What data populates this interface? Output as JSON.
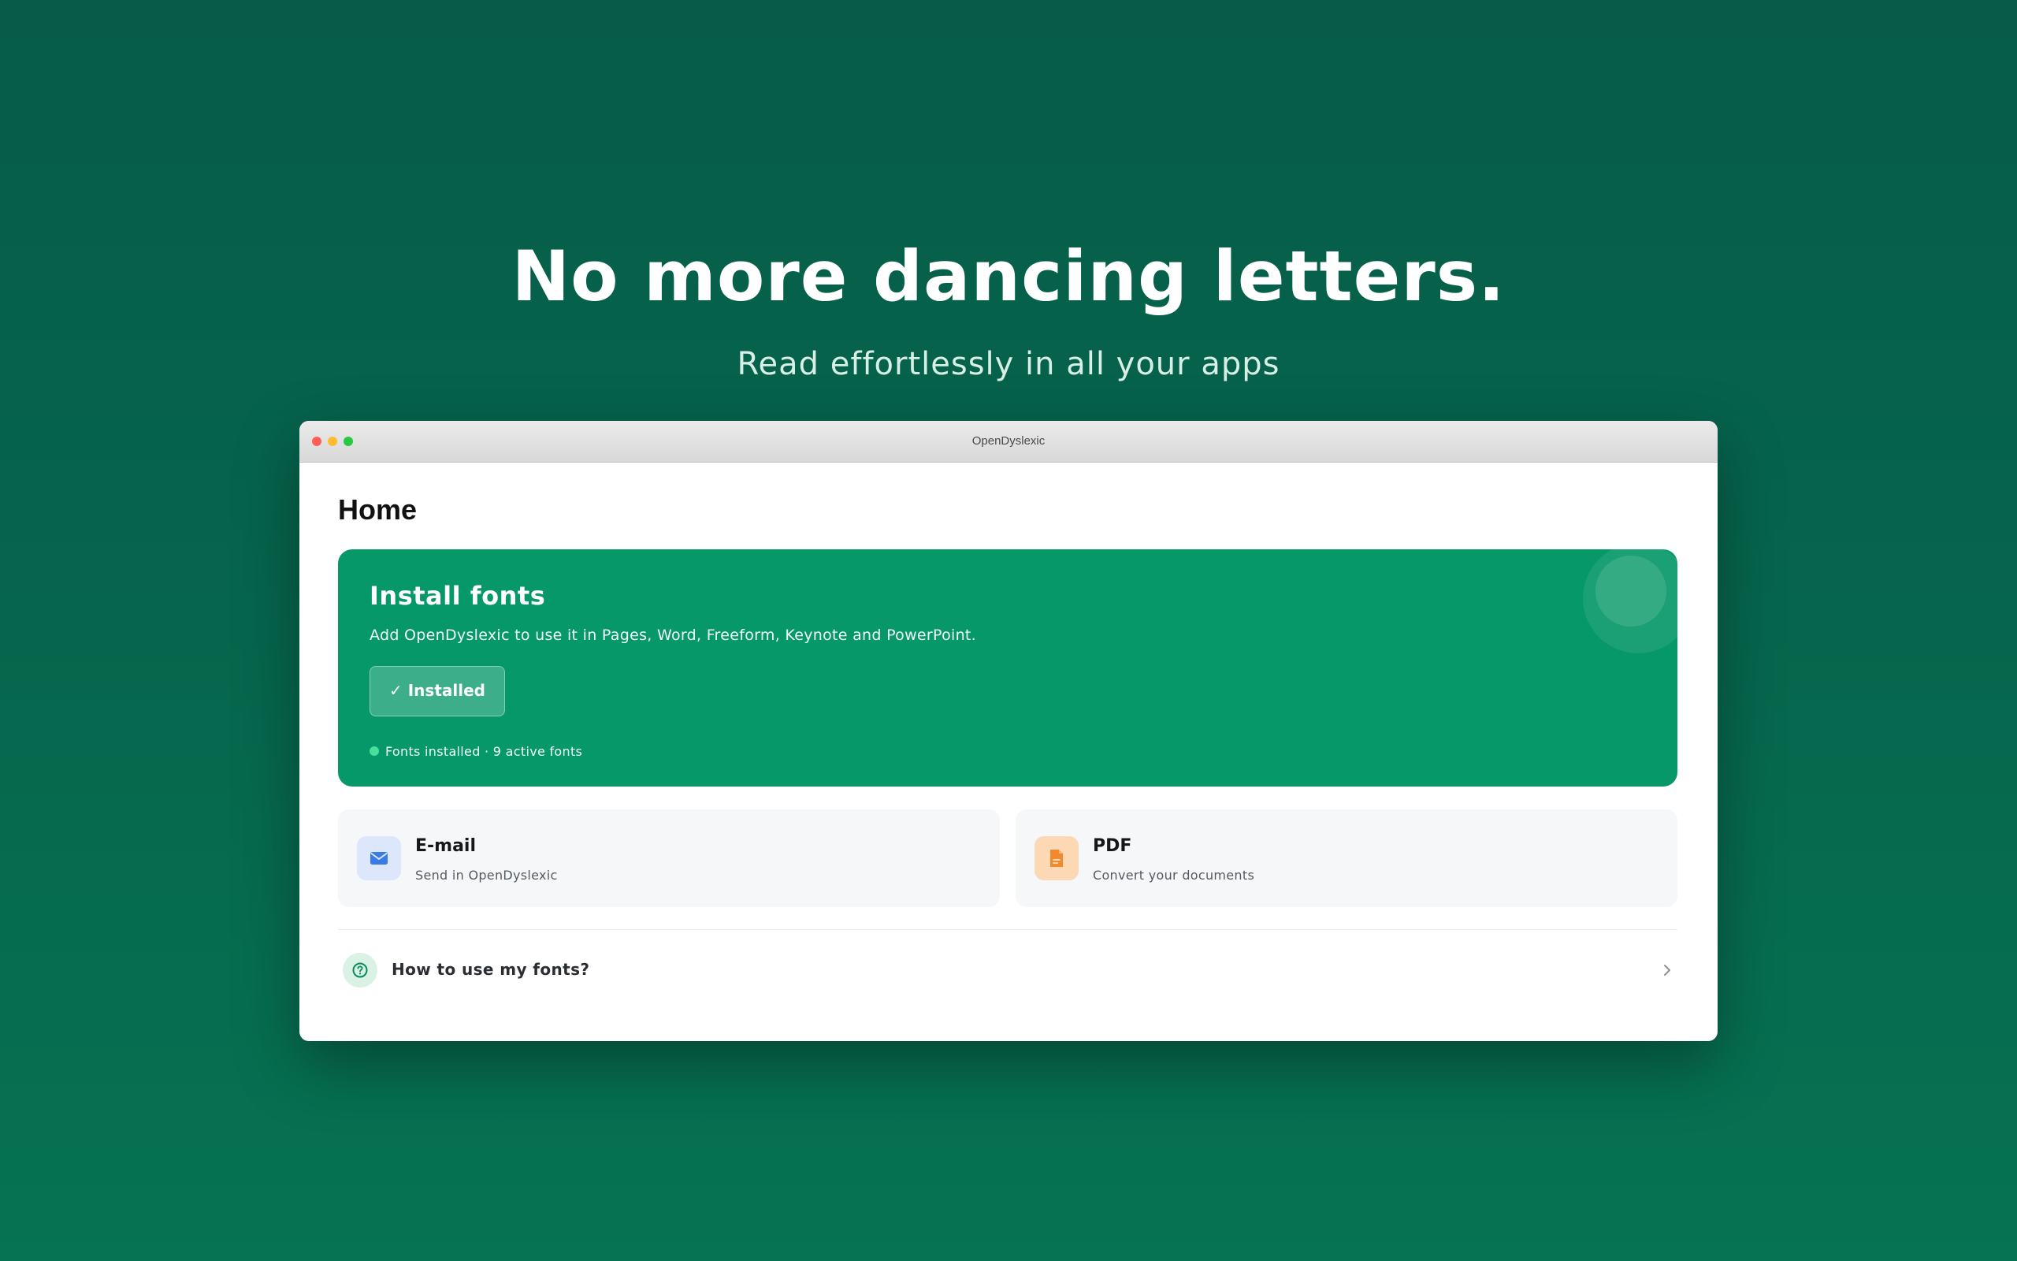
{
  "hero": {
    "headline": "No more dancing letters.",
    "subheadline": "Read effortlessly in all your apps"
  },
  "window": {
    "title": "OpenDyslexic"
  },
  "page": {
    "title": "Home"
  },
  "install_card": {
    "title": "Install fonts",
    "description": "Add OpenDyslexic to use it in Pages, Word, Freeform, Keynote and PowerPoint.",
    "button_label": "✓ Installed",
    "status_text": "Fonts installed · 9 active fonts",
    "color": "#079869"
  },
  "features": [
    {
      "title": "E-mail",
      "subtitle": "Send in OpenDyslexic",
      "icon": "mail-icon",
      "accent": "#3b7be6"
    },
    {
      "title": "PDF",
      "subtitle": "Convert your documents",
      "icon": "pdf-icon",
      "accent": "#f08a2c"
    }
  ],
  "help": {
    "label": "How to use my fonts?",
    "icon": "question-icon"
  },
  "colors": {
    "background": "#06664d",
    "accent": "#079869"
  }
}
